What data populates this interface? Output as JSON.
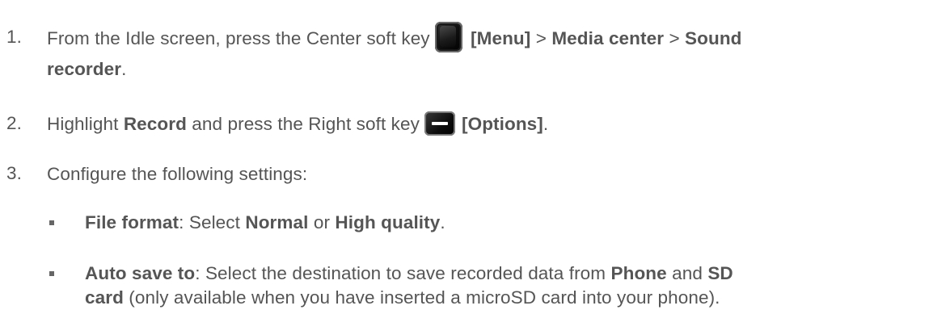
{
  "steps": [
    {
      "number": "1.",
      "text_a": "From the Idle screen, press the Center soft key",
      "key_label": "[Menu]",
      "sep1": ">",
      "menu1": "Media center",
      "sep2": ">",
      "menu2_a": "Sound",
      "menu2_b": "recorder",
      "end": "."
    },
    {
      "number": "2.",
      "text_a": "Highlight",
      "item": "Record",
      "text_b": "and press the Right soft key",
      "key_label": "[Options]",
      "end": "."
    },
    {
      "number": "3.",
      "text_a": "Configure the following settings:"
    }
  ],
  "bullets": [
    {
      "label": "File format",
      "colon": ":",
      "text_a": "Select",
      "opt1": "Normal",
      "or": "or",
      "opt2": "High quality",
      "end": "."
    },
    {
      "label": "Auto save to",
      "colon": ":",
      "text_a": "Select the destination to save recorded data from",
      "opt1": "Phone",
      "and": "and",
      "opt2_a": "SD",
      "opt2_b": "card",
      "text_b": "(only available when you have inserted a microSD card into your phone)."
    }
  ],
  "icons": {
    "center_key": "center-soft-key-icon",
    "right_key": "right-soft-key-icon"
  }
}
